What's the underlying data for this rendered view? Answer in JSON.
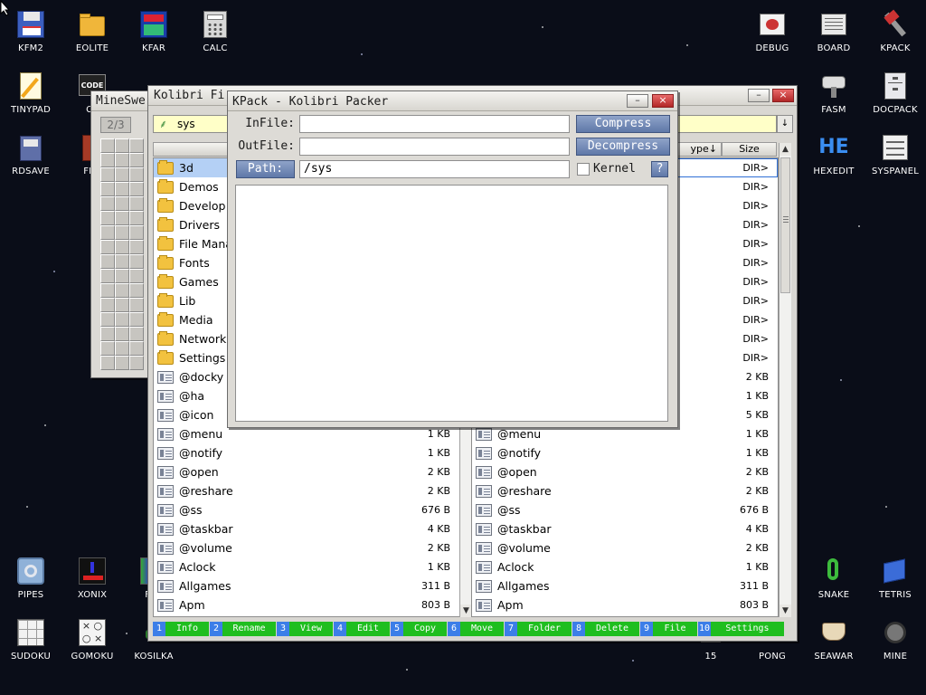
{
  "desktop": {
    "icons": [
      {
        "key": "kfm2",
        "label": "KFM2"
      },
      {
        "key": "eolite",
        "label": "EOLITE"
      },
      {
        "key": "kfar",
        "label": "KFAR"
      },
      {
        "key": "calc",
        "label": "CALC"
      },
      {
        "key": "tinypad",
        "label": "TINYPAD"
      },
      {
        "key": "cedit",
        "label": "CE"
      },
      {
        "key": "rdsave",
        "label": "RDSAVE"
      },
      {
        "key": "fb2",
        "label": "FB2"
      },
      {
        "key": "debug",
        "label": "DEBUG"
      },
      {
        "key": "board",
        "label": "BOARD"
      },
      {
        "key": "kpack",
        "label": "KPACK"
      },
      {
        "key": "fasm",
        "label": "FASM"
      },
      {
        "key": "docpack",
        "label": "DOCPACK"
      },
      {
        "key": "hexedit",
        "label": "HEXEDIT"
      },
      {
        "key": "syspanel",
        "label": "SYSPANEL"
      },
      {
        "key": "pipes",
        "label": "PIPES"
      },
      {
        "key": "xonix",
        "label": "XONIX"
      },
      {
        "key": "flood",
        "label": "FLO"
      },
      {
        "key": "snake",
        "label": "SNAKE"
      },
      {
        "key": "tetris",
        "label": "TETRIS"
      },
      {
        "key": "sudoku",
        "label": "SUDOKU"
      },
      {
        "key": "gomoku",
        "label": "GOMOKU"
      },
      {
        "key": "kosilka",
        "label": "KOSILKA"
      },
      {
        "key": "fifteen",
        "label": "15"
      },
      {
        "key": "pong",
        "label": "PONG"
      },
      {
        "key": "seawar",
        "label": "SEAWAR"
      },
      {
        "key": "mine",
        "label": "MINE"
      }
    ],
    "hexedit_glyph": "HE"
  },
  "minesweeper": {
    "title": "MineSwe",
    "counter": "2/3"
  },
  "filemanager": {
    "title": "Kolibri Fi",
    "address": "sys",
    "right_header": {
      "type": "ype↓",
      "size": "Size"
    },
    "left_rows": [
      {
        "name": "3d",
        "type": "folder",
        "size": ""
      },
      {
        "name": "Demos",
        "type": "folder",
        "size": ""
      },
      {
        "name": "Develop",
        "type": "folder",
        "size": ""
      },
      {
        "name": "Drivers",
        "type": "folder",
        "size": ""
      },
      {
        "name": "File Mana",
        "type": "folder",
        "size": ""
      },
      {
        "name": "Fonts",
        "type": "folder",
        "size": ""
      },
      {
        "name": "Games",
        "type": "folder",
        "size": ""
      },
      {
        "name": "Lib",
        "type": "folder",
        "size": ""
      },
      {
        "name": "Media",
        "type": "folder",
        "size": ""
      },
      {
        "name": "Network",
        "type": "folder",
        "size": ""
      },
      {
        "name": "Settings",
        "type": "folder",
        "size": ""
      },
      {
        "name": "@docky",
        "type": "file",
        "size": ""
      },
      {
        "name": "@ha",
        "type": "file",
        "size": ""
      },
      {
        "name": "@icon",
        "type": "file",
        "size": ""
      },
      {
        "name": "@menu",
        "type": "file",
        "size": "1 KB"
      },
      {
        "name": "@notify",
        "type": "file",
        "size": "1 KB"
      },
      {
        "name": "@open",
        "type": "file",
        "size": "2 KB"
      },
      {
        "name": "@reshare",
        "type": "file",
        "size": "2 KB"
      },
      {
        "name": "@ss",
        "type": "file",
        "size": "676 B"
      },
      {
        "name": "@taskbar",
        "type": "file",
        "size": "4 KB"
      },
      {
        "name": "@volume",
        "type": "file",
        "size": "2 KB"
      },
      {
        "name": "Aclock",
        "type": "file",
        "size": "1 KB"
      },
      {
        "name": "Allgames",
        "type": "file",
        "size": "311 B"
      },
      {
        "name": "Apm",
        "type": "file",
        "size": "803 B"
      }
    ],
    "right_rows": [
      {
        "name": "",
        "type": "folder",
        "size": "DIR>"
      },
      {
        "name": "",
        "type": "folder",
        "size": "DIR>"
      },
      {
        "name": "",
        "type": "folder",
        "size": "DIR>"
      },
      {
        "name": "",
        "type": "folder",
        "size": "DIR>"
      },
      {
        "name": "",
        "type": "folder",
        "size": "DIR>"
      },
      {
        "name": "",
        "type": "folder",
        "size": "DIR>"
      },
      {
        "name": "",
        "type": "folder",
        "size": "DIR>"
      },
      {
        "name": "",
        "type": "folder",
        "size": "DIR>"
      },
      {
        "name": "",
        "type": "folder",
        "size": "DIR>"
      },
      {
        "name": "",
        "type": "folder",
        "size": "DIR>"
      },
      {
        "name": "",
        "type": "folder",
        "size": "DIR>"
      },
      {
        "name": "",
        "type": "file",
        "size": "2 KB"
      },
      {
        "name": "",
        "type": "file",
        "size": "1 KB"
      },
      {
        "name": "",
        "type": "file",
        "size": "5 KB"
      },
      {
        "name": "@menu",
        "type": "file",
        "size": "1 KB"
      },
      {
        "name": "@notify",
        "type": "file",
        "size": "1 KB"
      },
      {
        "name": "@open",
        "type": "file",
        "size": "2 KB"
      },
      {
        "name": "@reshare",
        "type": "file",
        "size": "2 KB"
      },
      {
        "name": "@ss",
        "type": "file",
        "size": "676 B"
      },
      {
        "name": "@taskbar",
        "type": "file",
        "size": "4 KB"
      },
      {
        "name": "@volume",
        "type": "file",
        "size": "2 KB"
      },
      {
        "name": "Aclock",
        "type": "file",
        "size": "1 KB"
      },
      {
        "name": "Allgames",
        "type": "file",
        "size": "311 B"
      },
      {
        "name": "Apm",
        "type": "file",
        "size": "803 B"
      }
    ],
    "fkeys": [
      {
        "num": "1",
        "label": "Info"
      },
      {
        "num": "2",
        "label": "Rename"
      },
      {
        "num": "3",
        "label": "View"
      },
      {
        "num": "4",
        "label": "Edit"
      },
      {
        "num": "5",
        "label": "Copy"
      },
      {
        "num": "6",
        "label": "Move"
      },
      {
        "num": "7",
        "label": "Folder"
      },
      {
        "num": "8",
        "label": "Delete"
      },
      {
        "num": "9",
        "label": "File"
      },
      {
        "num": "10",
        "label": "Settings"
      }
    ]
  },
  "kpack": {
    "title": "KPack - Kolibri Packer",
    "infile_label": "InFile:",
    "outfile_label": "OutFile:",
    "path_button": "Path:",
    "infile_value": "",
    "outfile_value": "",
    "path_value": "/sys",
    "compress_button": "Compress",
    "decompress_button": "Decompress",
    "kernel_label": "Kernel",
    "help_button": "?",
    "minimize_glyph": "–",
    "close_glyph": "×"
  },
  "colors": {
    "fkey_number_bg": "#3c7ee8",
    "fkey_label_bg": "#1fbe1f",
    "kpack_button": "#6f86b4",
    "address_bar": "#ffffc8"
  }
}
